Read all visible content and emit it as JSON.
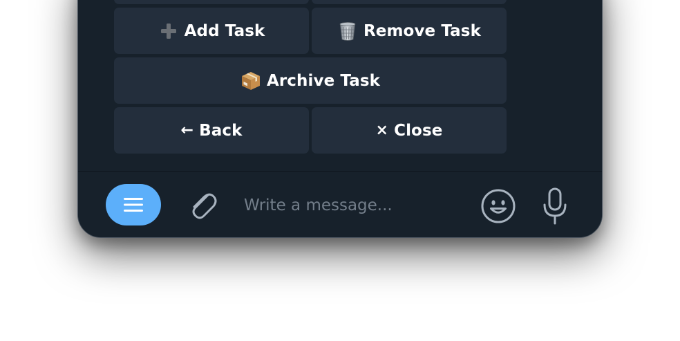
{
  "keyboard": {
    "add_task": {
      "label": "Add Task",
      "icon": "plus-icon"
    },
    "remove_task": {
      "label": "Remove Task",
      "icon": "wastebasket-icon"
    },
    "archive_task": {
      "label": "Archive Task",
      "icon": "package-icon"
    },
    "back": {
      "label": "Back",
      "icon": "←"
    },
    "close": {
      "label": "Close",
      "icon": "×"
    }
  },
  "composer": {
    "menu_icon": "menu-icon",
    "attach_icon": "paperclip-icon",
    "placeholder": "Write a message...",
    "emoji_icon": "smiley-icon",
    "mic_icon": "microphone-icon"
  },
  "colors": {
    "window_bg": "#17212b",
    "button_bg": "#232e3c",
    "accent": "#5caffa",
    "placeholder": "#737e8a",
    "icon": "#a8b3bf"
  }
}
